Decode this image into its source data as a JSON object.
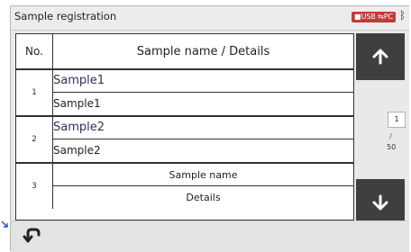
{
  "window": {
    "title": "Sample registration"
  },
  "status": {
    "usb_label": "USB",
    "pc_label": "PC"
  },
  "table": {
    "header_no": "No.",
    "header_name": "Sample name / Details",
    "rows": [
      {
        "no": "1",
        "name": "Sample1",
        "details": "Sample1",
        "empty": false
      },
      {
        "no": "2",
        "name": "Sample2",
        "details": "Sample2",
        "empty": false
      },
      {
        "no": "3",
        "name": "Sample name",
        "details": "Details",
        "empty": true
      }
    ]
  },
  "pager": {
    "current": "1",
    "separator": "/",
    "total": "50"
  },
  "colors": {
    "accent": "#c23b3b",
    "button_dark": "#3f3f3f"
  }
}
